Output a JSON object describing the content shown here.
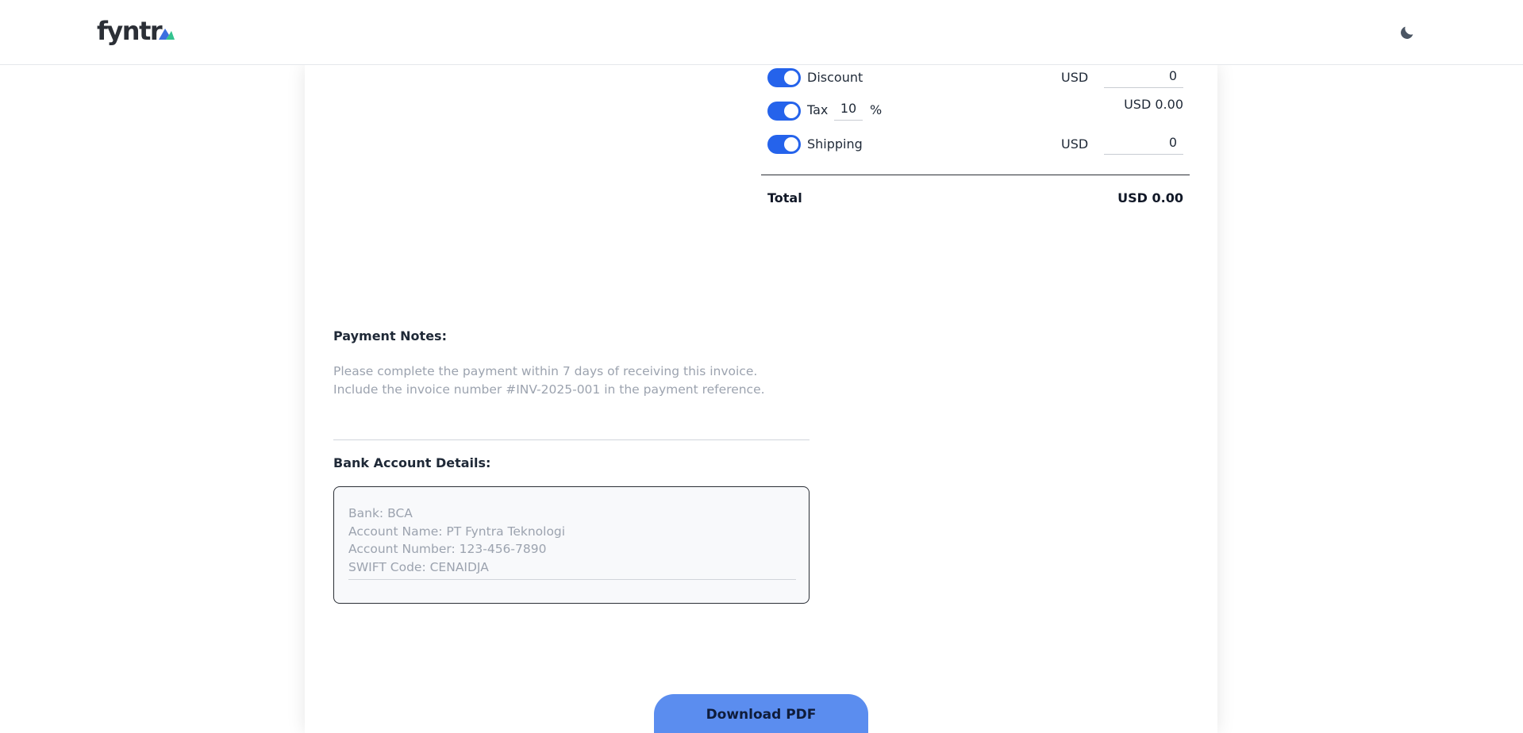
{
  "header": {
    "logo_text": "fyntr",
    "theme_icon": "moon-icon"
  },
  "totals": {
    "discount": {
      "label": "Discount",
      "enabled": true,
      "currency": "USD",
      "value": "0"
    },
    "tax": {
      "label": "Tax",
      "enabled": true,
      "rate": "10",
      "percent_sign": "%",
      "amount": "USD 0.00"
    },
    "shipping": {
      "label": "Shipping",
      "enabled": true,
      "currency": "USD",
      "value": "0"
    },
    "total_label": "Total",
    "total_value": "USD 0.00"
  },
  "payment_notes": {
    "label": "Payment Notes:",
    "line1": "Please complete the payment within 7 days of receiving this invoice.",
    "line2": "Include the invoice number #INV-2025-001 in the payment reference."
  },
  "bank_details": {
    "label": "Bank Account Details:",
    "line1": "Bank: BCA",
    "line2": "Account Name: PT Fyntra Teknologi",
    "line3": "Account Number: 123-456-7890",
    "line4": "SWIFT Code: CENAIDJA"
  },
  "actions": {
    "download_label": "Download PDF"
  },
  "colors": {
    "accent": "#2563eb",
    "button": "#5b8def",
    "logo_mark_blue": "#3b6fe0",
    "logo_mark_green": "#34c38f"
  }
}
